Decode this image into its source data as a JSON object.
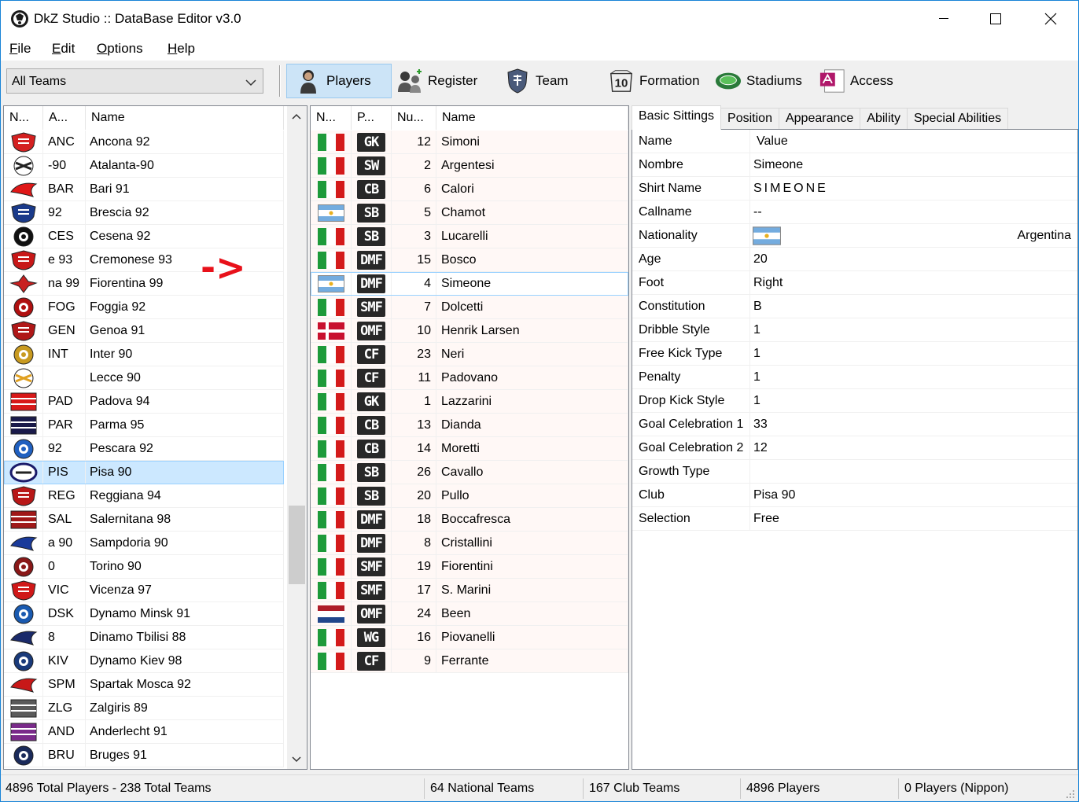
{
  "window": {
    "title": "DkZ Studio :: DataBase Editor v3.0"
  },
  "menu": [
    {
      "label": "File",
      "u": "F",
      "rest": "ile"
    },
    {
      "label": "Edit",
      "u": "E",
      "rest": "dit"
    },
    {
      "label": "Options",
      "u": "O",
      "rest": "ptions"
    },
    {
      "label": "Help",
      "u": "H",
      "rest": "elp"
    }
  ],
  "toolbar": {
    "team_filter": "All Teams",
    "buttons": [
      {
        "label": "Players",
        "icon": "player-icon",
        "active": true
      },
      {
        "label": "Register",
        "icon": "register-icon"
      },
      {
        "label": "Team",
        "icon": "team-shield-icon"
      },
      {
        "label": "Formation",
        "icon": "formation-icon"
      },
      {
        "label": "Stadiums",
        "icon": "stadium-icon"
      },
      {
        "label": "Access",
        "icon": "access-icon"
      }
    ]
  },
  "teams": {
    "headers": [
      "N...",
      "A...",
      "Name"
    ],
    "rows": [
      {
        "abbr": "ANC",
        "name": "Ancona 92",
        "color": "#d42020"
      },
      {
        "abbr": "-90",
        "name": "Atalanta-90",
        "color": "#222222"
      },
      {
        "abbr": "BAR",
        "name": "Bari 91",
        "color": "#e01818"
      },
      {
        "abbr": "92",
        "name": "Brescia 92",
        "color": "#1a3a8a"
      },
      {
        "abbr": "CES",
        "name": "Cesena 92",
        "color": "#111111"
      },
      {
        "abbr": "e 93",
        "name": "Cremonese 93",
        "color": "#c81818"
      },
      {
        "abbr": "na 99",
        "name": "Fiorentina 99",
        "color": "#c82020"
      },
      {
        "abbr": "FOG",
        "name": "Foggia 92",
        "color": "#b01010"
      },
      {
        "abbr": "GEN",
        "name": "Genoa 91",
        "color": "#b01818"
      },
      {
        "abbr": "INT",
        "name": "Inter 90",
        "color": "#c89a20"
      },
      {
        "abbr": "",
        "name": "Lecce 90",
        "color": "#e0a020"
      },
      {
        "abbr": "PAD",
        "name": "Padova 94",
        "color": "#d81818"
      },
      {
        "abbr": "PAR",
        "name": "Parma 95",
        "color": "#1a1a4a"
      },
      {
        "abbr": "92",
        "name": "Pescara 92",
        "color": "#2060c0"
      },
      {
        "abbr": "PIS",
        "name": "Pisa 90",
        "color": "#1a1a6a",
        "selected": true
      },
      {
        "abbr": "REG",
        "name": "Reggiana 94",
        "color": "#b81818"
      },
      {
        "abbr": "SAL",
        "name": "Salernitana 98",
        "color": "#a01818"
      },
      {
        "abbr": "a 90",
        "name": "Sampdoria 90",
        "color": "#1a3a9a"
      },
      {
        "abbr": "0",
        "name": "Torino 90",
        "color": "#8a1818"
      },
      {
        "abbr": "VIC",
        "name": "Vicenza 97",
        "color": "#d01818"
      },
      {
        "abbr": "DSK",
        "name": "Dynamo Minsk 91",
        "color": "#1a5ab0"
      },
      {
        "abbr": "8",
        "name": "Dinamo Tbilisi 88",
        "color": "#1a2a6a"
      },
      {
        "abbr": "KIV",
        "name": "Dynamo Kiev 98",
        "color": "#1a3a7a"
      },
      {
        "abbr": "SPM",
        "name": "Spartak Mosca 92",
        "color": "#c81818"
      },
      {
        "abbr": "ZLG",
        "name": "Zalgiris 89",
        "color": "#5a5a5a"
      },
      {
        "abbr": "AND",
        "name": "Anderlecht 91",
        "color": "#7a2a8a"
      },
      {
        "abbr": "BRU",
        "name": "Bruges 91",
        "color": "#1a2a5a"
      }
    ]
  },
  "players": {
    "headers": [
      "N...",
      "P...",
      "Nu...",
      "Name"
    ],
    "rows": [
      {
        "flag": "italy",
        "pos": "GK",
        "num": "12",
        "name": "Simoni"
      },
      {
        "flag": "italy",
        "pos": "SW",
        "num": "2",
        "name": "Argentesi"
      },
      {
        "flag": "italy",
        "pos": "CB",
        "num": "6",
        "name": "Calori"
      },
      {
        "flag": "argentina",
        "pos": "SB",
        "num": "5",
        "name": "Chamot"
      },
      {
        "flag": "italy",
        "pos": "SB",
        "num": "3",
        "name": "Lucarelli"
      },
      {
        "flag": "italy",
        "pos": "DMF",
        "num": "15",
        "name": "Bosco"
      },
      {
        "flag": "argentina",
        "pos": "DMF",
        "num": "4",
        "name": "Simeone",
        "selected": true
      },
      {
        "flag": "italy",
        "pos": "SMF",
        "num": "7",
        "name": "Dolcetti"
      },
      {
        "flag": "denmark",
        "pos": "OMF",
        "num": "10",
        "name": "Henrik Larsen"
      },
      {
        "flag": "italy",
        "pos": "CF",
        "num": "23",
        "name": "Neri"
      },
      {
        "flag": "italy",
        "pos": "CF",
        "num": "11",
        "name": "Padovano"
      },
      {
        "flag": "italy",
        "pos": "GK",
        "num": "1",
        "name": "Lazzarini"
      },
      {
        "flag": "italy",
        "pos": "CB",
        "num": "13",
        "name": "Dianda"
      },
      {
        "flag": "italy",
        "pos": "CB",
        "num": "14",
        "name": "Moretti"
      },
      {
        "flag": "italy",
        "pos": "SB",
        "num": "26",
        "name": "Cavallo"
      },
      {
        "flag": "italy",
        "pos": "SB",
        "num": "20",
        "name": "Pullo"
      },
      {
        "flag": "italy",
        "pos": "DMF",
        "num": "18",
        "name": "Boccafresca"
      },
      {
        "flag": "italy",
        "pos": "DMF",
        "num": "8",
        "name": "Cristallini"
      },
      {
        "flag": "italy",
        "pos": "SMF",
        "num": "19",
        "name": "Fiorentini"
      },
      {
        "flag": "italy",
        "pos": "SMF",
        "num": "17",
        "name": "S. Marini"
      },
      {
        "flag": "netherlands",
        "pos": "OMF",
        "num": "24",
        "name": "Been"
      },
      {
        "flag": "italy",
        "pos": "WG",
        "num": "16",
        "name": "Piovanelli"
      },
      {
        "flag": "italy",
        "pos": "CF",
        "num": "9",
        "name": "Ferrante"
      }
    ]
  },
  "annotation": "->",
  "tabs": [
    "Basic Sittings",
    "Position",
    "Appearance",
    "Ability",
    "Special Abilities"
  ],
  "info": {
    "headers": [
      "Name",
      "Value"
    ],
    "rows": [
      {
        "key": "Nombre",
        "value": "Simeone"
      },
      {
        "key": "Shirt Name",
        "value": "SIMEONE",
        "spaced": true
      },
      {
        "key": "Callname",
        "value": "--"
      },
      {
        "key": "Nationality",
        "value": "Argentina",
        "flag": "argentina"
      },
      {
        "key": "Age",
        "value": "20"
      },
      {
        "key": "Foot",
        "value": "Right"
      },
      {
        "key": "Constitution",
        "value": "B"
      },
      {
        "key": "Dribble Style",
        "value": "1"
      },
      {
        "key": "Free Kick Type",
        "value": "1"
      },
      {
        "key": "Penalty",
        "value": "1"
      },
      {
        "key": "Drop Kick Style",
        "value": "1"
      },
      {
        "key": "Goal Celebration 1",
        "value": "33"
      },
      {
        "key": "Goal Celebration 2",
        "value": "12"
      },
      {
        "key": "Growth Type",
        "value": ""
      },
      {
        "key": "Club",
        "value": "Pisa 90"
      },
      {
        "key": "Selection",
        "value": "Free"
      }
    ]
  },
  "status": {
    "totals": "4896 Total Players  -  238 Total Teams",
    "national": "64 National Teams",
    "club": "167 Club Teams",
    "players": "4896 Players",
    "nippon": "0 Players (Nippon)"
  }
}
